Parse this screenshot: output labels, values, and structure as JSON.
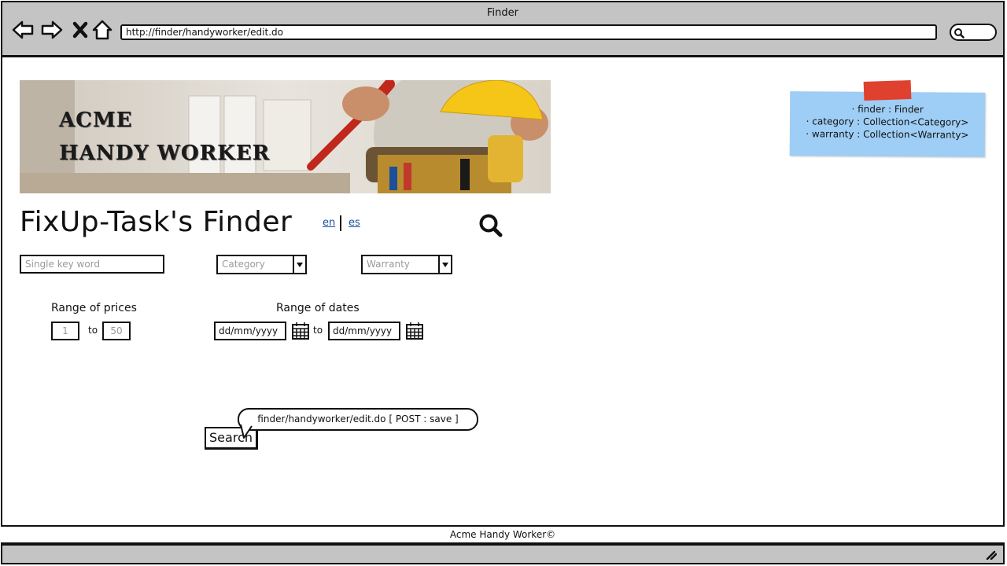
{
  "window": {
    "title": "Finder"
  },
  "browser": {
    "url": "http://finder/handyworker/edit.do"
  },
  "banner": {
    "line1": "ACME",
    "line2": "HANDY WORKER"
  },
  "note": {
    "lines": [
      "· finder : Finder",
      "· category : Collection<Category>",
      "· warranty : Collection<Warranty>"
    ]
  },
  "page": {
    "title": "FixUp-Task's Finder",
    "lang_en": "en",
    "lang_es": "es"
  },
  "filters": {
    "keyword_placeholder": "Single key word",
    "category_placeholder": "Category",
    "warranty_placeholder": "Warranty",
    "price_label": "Range of prices",
    "price_min": "1",
    "price_to": "to",
    "price_max": "50",
    "dates_label": "Range of dates",
    "date_from": "dd/mm/yyyy",
    "date_to_word": "to",
    "date_to": "dd/mm/yyyy"
  },
  "action": {
    "search_label": "Search",
    "tooltip": "finder/handyworker/edit.do [ POST : save ]"
  },
  "footer": {
    "text": "Acme Handy Worker©"
  },
  "colors": {
    "chrome": "#c4c4c4",
    "note": "#9ecdf5",
    "tape": "#e0412f",
    "link": "#1a4fa0"
  }
}
